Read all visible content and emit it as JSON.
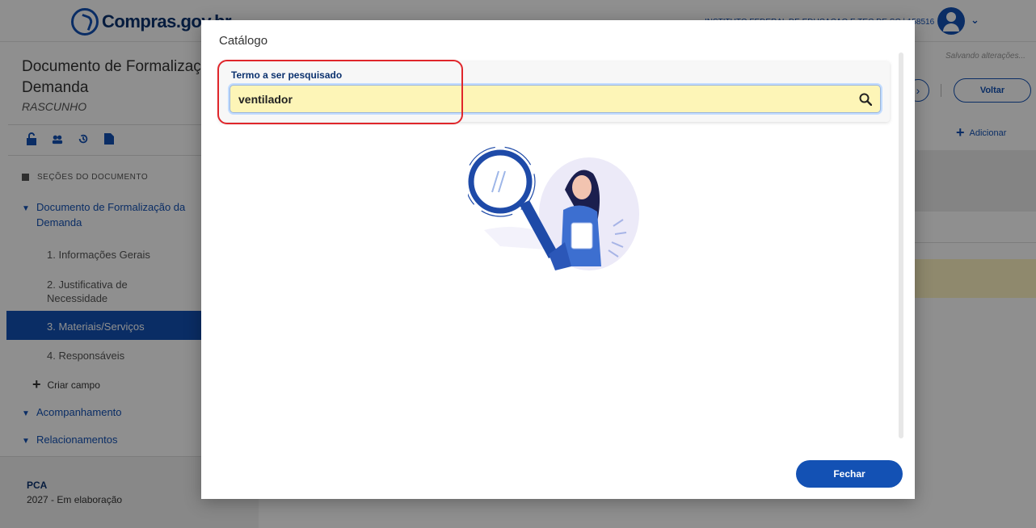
{
  "header": {
    "logo_text": "Compras.gov.br",
    "org_text": "INSTITUTO FEDERAL DE EDUCACAO E TEC DE SC | 158516"
  },
  "sidebar": {
    "doc_title": "Documento de Formalização da Demanda",
    "doc_status": "RASCUNHO",
    "sections_label": "SEÇÕES DO DOCUMENTO",
    "parent_label": "Documento de Formalização da Demanda",
    "items": [
      {
        "label": "1. Informações Gerais"
      },
      {
        "label": "2. Justificativa de Necessidade"
      },
      {
        "label": "3. Materiais/Serviços"
      },
      {
        "label": "4. Responsáveis"
      }
    ],
    "add_field_label": "Criar campo",
    "section_tracking": "Acompanhamento",
    "section_relations": "Relacionamentos",
    "pca_label": "PCA",
    "pca_year": "2027 - Em elaboração"
  },
  "main": {
    "saving_text": "Salvando alterações...",
    "back_label": "Voltar",
    "add_label": "Adicionar"
  },
  "modal": {
    "title": "Catálogo",
    "search_label": "Termo a ser pesquisado",
    "search_value": "ventilador",
    "close_label": "Fechar"
  },
  "colors": {
    "primary": "#1351b4",
    "dark_blue": "#0c326f",
    "search_highlight": "#fdf5b7",
    "annotation_red": "#e0262b"
  }
}
